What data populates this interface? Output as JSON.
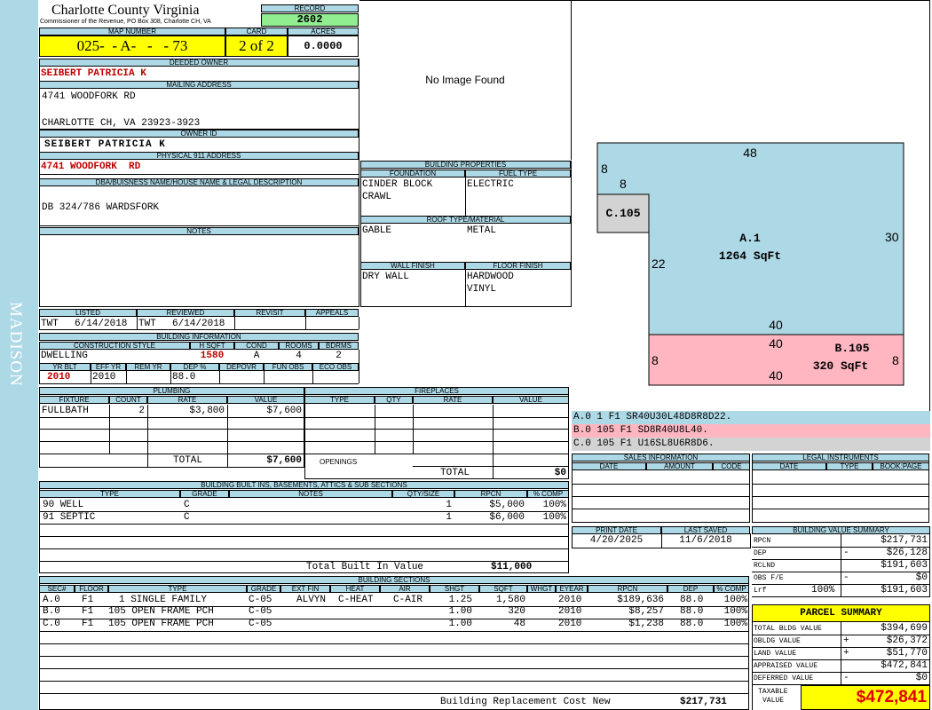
{
  "sidebar": {
    "district": "MADISON"
  },
  "header": {
    "county": "Charlotte County Virginia",
    "commissioner": "Commissioner of the Revenue, PO Box 308, Charlotte CH, VA",
    "record_label": "RECORD",
    "record": "2602",
    "map_label": "MAP NUMBER",
    "map_number": "025-  - A-   -   - 73",
    "card_label": "CARD",
    "card": "2 of 2",
    "acres_label": "ACRES",
    "acres": "0.0000"
  },
  "owner": {
    "deeded_label": "DEEDED OWNER",
    "deeded": "SEIBERT PATRICIA K",
    "mailing_label": "MAILING ADDRESS",
    "mail1": "4741 WOODFORK RD",
    "mail2": "CHARLOTTE CH, VA 23923-3923",
    "ownerid_label": "OWNER ID",
    "ownerid": "SEIBERT PATRICIA K",
    "phys_label": "PHYSICAL 911 ADDRESS",
    "phys": "4741 WOODFORK  RD",
    "dba_label": "DBA/BUISNESS NAME/HOUSE NAME & LEGAL DESCRIPTION",
    "dba": "DB 324/786  WARDSFORK",
    "notes_label": "NOTES"
  },
  "image": {
    "text": "No Image Found"
  },
  "review": {
    "listed_label": "LISTED",
    "reviewed_label": "REVIEWED",
    "revisit_label": "REVISIT",
    "appeals_label": "APPEALS",
    "listed_by": "TWT",
    "listed_date": "6/14/2018",
    "reviewed_by": "TWT",
    "reviewed_date": "6/14/2018"
  },
  "bldginfo": {
    "title": "BUILDING INFORMATION",
    "cs_label": "CONSTRUCTION STYLE",
    "hsqft_label": "H SQFT",
    "cond_label": "COND",
    "rooms_label": "ROOMS",
    "bdrms_label": "BDRMS",
    "style": "DWELLING",
    "hsqft": "1580",
    "cond": "A",
    "rooms": "4",
    "bdrms": "2",
    "yrblt_label": "YR BLT",
    "effyr_label": "EFF YR",
    "remyr_label": "REM YR",
    "dep_label": "DEP %",
    "depovr_label": "DEPOVR",
    "funobs_label": "FUN OBS",
    "ecoobs_label": "ECO OBS",
    "yrblt": "2010",
    "effyr": "2010",
    "dep": "88.0"
  },
  "props": {
    "title": "BUILDING PROPERTIES",
    "foundation_label": "FOUNDATION",
    "fuel_label": "FUEL TYPE",
    "foundation1": "CINDER BLOCK",
    "foundation2": "CRAWL",
    "fuel": "ELECTRIC",
    "roof_label": "ROOF TYPE/MATERIAL",
    "roof1": "GABLE",
    "roof2": "METAL",
    "wall_label": "WALL FINISH",
    "floor_label": "FLOOR FINISH",
    "wall": "DRY WALL",
    "floor1": "HARDWOOD",
    "floor2": "VINYL"
  },
  "sketch": {
    "a_label": "A.1",
    "a_area": "1264 SqFt",
    "b_label": "B.105",
    "b_area": "320 SqFt",
    "c_label": "C.105",
    "dims": {
      "top": "48",
      "left_top": "8",
      "notch": "8",
      "right": "30",
      "left": "22",
      "mid": "40",
      "b_top": "40",
      "b_left": "8",
      "b_right": "8",
      "b_bottom": "40"
    }
  },
  "vectors": [
    {
      "text": "A.0  1    F1  SR40U30L48D8R8D22.",
      "bg": "#add8e6"
    },
    {
      "text": "B.0  105  F1  SD8R40U8L40.",
      "bg": "#ffb6c1"
    },
    {
      "text": "C.0  105  F1  U16SL8U6R8D6.",
      "bg": "#d3d3d3"
    }
  ],
  "plumbing": {
    "title": "PLUMBING",
    "headers": [
      "FIXTURE",
      "COUNT",
      "RATE",
      "VALUE"
    ],
    "rows": [
      {
        "fixture": "FULLBATH",
        "count": "2",
        "rate": "$3,800",
        "value": "$7,600"
      }
    ],
    "total_label": "TOTAL",
    "total": "$7,600"
  },
  "fireplaces": {
    "title": "FIREPLACES",
    "headers": [
      "TYPE",
      "QTY",
      "RATE",
      "VALUE"
    ],
    "openings_label": "OPENINGS",
    "total_label": "TOTAL",
    "total": "$0"
  },
  "sales": {
    "title": "SALES INFORMATION",
    "headers": [
      "DATE",
      "AMOUNT",
      "CODE"
    ]
  },
  "legal": {
    "title": "LEGAL INSTRUMENTS",
    "headers": [
      "DATE",
      "TYPE",
      "BOOK:PAGE"
    ]
  },
  "dates": {
    "print_label": "PRINT DATE",
    "saved_label": "LAST SAVED",
    "print": "4/20/2025",
    "saved": "11/6/2018"
  },
  "builtins": {
    "title": "BUILDING BUILT INS, BASEMENTS, ATTICS & SUB SECTIONS",
    "headers": [
      "TYPE",
      "GRADE",
      "NOTES",
      "QTY/SIZE",
      "RPCN",
      "% COMP"
    ],
    "rows": [
      {
        "type": "90 WELL",
        "grade": "C",
        "notes": "",
        "qty": "1",
        "rpcn": "$5,000",
        "comp": "100%"
      },
      {
        "type": "91 SEPTIC",
        "grade": "C",
        "notes": "",
        "qty": "1",
        "rpcn": "$6,000",
        "comp": "100%"
      }
    ],
    "total_label": "Total Built In Value",
    "total": "$11,000"
  },
  "sections": {
    "title": "BUILDING SECTIONS",
    "headers": [
      "SEC#",
      "FLOOR",
      "TYPE",
      "GRADE",
      "EXT FIN",
      "HEAT",
      "AIR",
      "SHGT",
      "SQFT",
      "WHGT",
      "EYEAR",
      "RPCN",
      "DEP",
      "% COMP"
    ],
    "rows": [
      {
        "sec": "A.0",
        "floor": "F1",
        "type": "1 SINGLE FAMILY",
        "grade": "C-05",
        "ext": "ALVYN",
        "heat": "C-HEAT",
        "air": "C-AIR",
        "shgt": "1.25",
        "sqft": "1,580",
        "whgt": "",
        "eyear": "2010",
        "rpcn": "$189,636",
        "dep": "88.0",
        "comp": "100%"
      },
      {
        "sec": "B.0",
        "floor": "F1",
        "type": "105 OPEN FRAME PCH",
        "grade": "C-05",
        "ext": "",
        "heat": "",
        "air": "",
        "shgt": "1.00",
        "sqft": "320",
        "whgt": "",
        "eyear": "2010",
        "rpcn": "$8,257",
        "dep": "88.0",
        "comp": "100%"
      },
      {
        "sec": "C.0",
        "floor": "F1",
        "type": "105 OPEN FRAME PCH",
        "grade": "C-05",
        "ext": "",
        "heat": "",
        "air": "",
        "shgt": "1.00",
        "sqft": "48",
        "whgt": "",
        "eyear": "2010",
        "rpcn": "$1,238",
        "dep": "88.0",
        "comp": "100%"
      }
    ],
    "total_label": "Building Replacement Cost New",
    "total": "$217,731"
  },
  "bvs": {
    "title": "BUILDING VALUE SUMMARY",
    "rpcn_label": "RPCN",
    "rpcn": "$217,731",
    "dep_label": "DEP",
    "dep_sign": "-",
    "dep": "$26,128",
    "rclnd_label": "RCLND",
    "rclnd": "$191,603",
    "obs_label": "OBS F/E",
    "obs_sign": "-",
    "obs": "$0",
    "lrf_label": "Lrf",
    "lrf_pct": "100%",
    "lrf": "$191,603"
  },
  "parcel": {
    "title": "PARCEL SUMMARY",
    "tbv_label": "TOTAL BLDG VALUE",
    "tbv": "$394,699",
    "obldg_label": "OBLDG VALUE",
    "obldg_sign": "+",
    "obldg": "$26,372",
    "land_label": "LAND VALUE",
    "land_sign": "+",
    "land": "$51,770",
    "appr_label": "APPRAISED VALUE",
    "appr": "$472,841",
    "def_label": "DEFERRED VALUE",
    "def_sign": "-",
    "def": "$0",
    "taxable_label1": "TAXABLE",
    "taxable_label2": "VALUE",
    "taxable": "$472,841"
  },
  "colors": {
    "label_bg": "#add8e6",
    "highlight": "#ffff00",
    "record_bg": "#90ee90",
    "sidebar": "#add8e6",
    "porch": "#ffb6c1",
    "stoop": "#d3d3d3"
  }
}
